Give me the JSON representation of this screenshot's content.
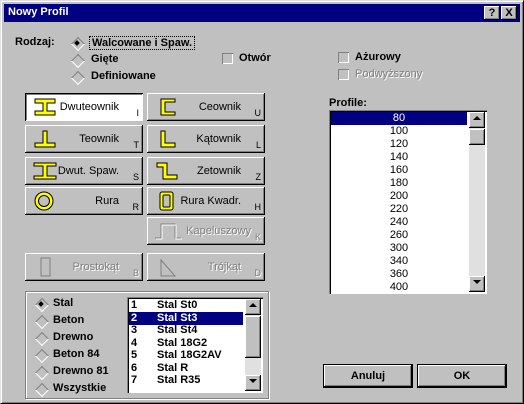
{
  "window": {
    "title": "Nowy Profil",
    "help_label": "?",
    "close_label": "X"
  },
  "rodzaj": {
    "label": "Rodzaj:",
    "options": [
      {
        "label": "Walcowane i Spaw.",
        "selected": true
      },
      {
        "label": "Gięte",
        "selected": false
      },
      {
        "label": "Definiowane",
        "selected": false
      }
    ]
  },
  "checkboxes": {
    "otwor": "Otwór",
    "azurowy": "Ażurowy",
    "podwyzszony": "Podwyższony"
  },
  "profile_buttons": [
    {
      "label": "Dwuteownik",
      "key": "I",
      "icon": "i-beam-icon",
      "selected": true,
      "enabled": true
    },
    {
      "label": "Ceownik",
      "key": "U",
      "icon": "channel-icon",
      "selected": false,
      "enabled": true
    },
    {
      "label": "Teownik",
      "key": "T",
      "icon": "tee-icon",
      "selected": false,
      "enabled": true
    },
    {
      "label": "Kątownik",
      "key": "L",
      "icon": "angle-icon",
      "selected": false,
      "enabled": true
    },
    {
      "label": "Dwut. Spaw.",
      "key": "S",
      "icon": "welded-i-beam-icon",
      "selected": false,
      "enabled": true
    },
    {
      "label": "Zetownik",
      "key": "Z",
      "icon": "zee-icon",
      "selected": false,
      "enabled": true
    },
    {
      "label": "Rura",
      "key": "R",
      "icon": "pipe-icon",
      "selected": false,
      "enabled": true
    },
    {
      "label": "Rura Kwadr.",
      "key": "H",
      "icon": "square-tube-icon",
      "selected": false,
      "enabled": true
    },
    {
      "label": "Kapeluszowy",
      "key": "K",
      "icon": "hat-icon",
      "selected": false,
      "enabled": false
    },
    {
      "label": "Prostokąt",
      "key": "B",
      "icon": "rectangle-icon",
      "selected": false,
      "enabled": false
    },
    {
      "label": "Trójkąt",
      "key": "D",
      "icon": "triangle-icon",
      "selected": false,
      "enabled": false
    }
  ],
  "profile_list": {
    "label": "Profile:",
    "items": [
      "80",
      "100",
      "120",
      "140",
      "160",
      "180",
      "200",
      "220",
      "240",
      "260",
      "300",
      "340",
      "360",
      "400"
    ],
    "selected_index": 0
  },
  "material": {
    "options": [
      {
        "label": "Stal",
        "selected": true
      },
      {
        "label": "Beton",
        "selected": false
      },
      {
        "label": "Drewno",
        "selected": false
      },
      {
        "label": "Beton 84",
        "selected": false
      },
      {
        "label": "Drewno 81",
        "selected": false
      },
      {
        "label": "Wszystkie",
        "selected": false
      }
    ]
  },
  "steel_list": {
    "items": [
      {
        "num": "1",
        "name": "Stal St0"
      },
      {
        "num": "2",
        "name": "Stal St3"
      },
      {
        "num": "3",
        "name": "Stal St4"
      },
      {
        "num": "4",
        "name": "Stal 18G2"
      },
      {
        "num": "5",
        "name": "Stal 18G2AV"
      },
      {
        "num": "6",
        "name": "Stal R"
      },
      {
        "num": "7",
        "name": "Stal R35"
      }
    ],
    "selected_index": 1
  },
  "buttons": {
    "cancel": "Anuluj",
    "ok": "OK"
  },
  "colors": {
    "titlebar": "#000080",
    "selection": "#000080",
    "icon_fill": "#ffff00",
    "face": "#c0c0c0"
  }
}
